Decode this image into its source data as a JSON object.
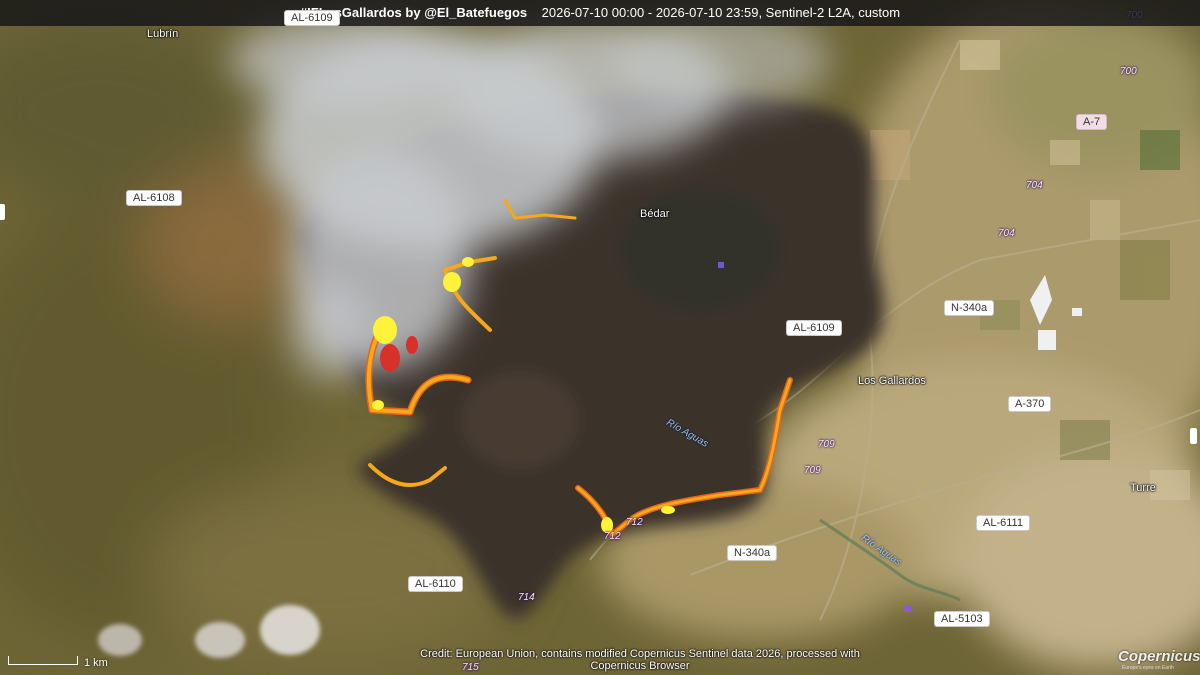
{
  "title": {
    "hashtag": "#IFLosGallardos",
    "author": "by @El_Batefuegos",
    "details": "2026-07-10 00:00 - 2026-07-10 23:59, Sentinel-2 L2A, custom"
  },
  "places": {
    "lubrin": "Lubrín",
    "bedar": "Bédar",
    "los_gallardos": "Los Gallardos",
    "turre": "Turre"
  },
  "roads": {
    "al6109_top": "AL-6109",
    "al6108": "AL-6108",
    "a7": "A-7",
    "n340a_east": "N-340a",
    "al6109_mid": "AL-6109",
    "a370": "A-370",
    "al6111": "AL-6111",
    "n340a_south": "N-340a",
    "al6110": "AL-6110",
    "al5103": "AL-5103"
  },
  "km_markers": {
    "k700a": "700",
    "k700b": "700",
    "k704a": "704",
    "k704b": "704",
    "k709a": "709",
    "k709b": "709",
    "k712a": "712",
    "k712b": "712",
    "k714": "714",
    "k715": "715"
  },
  "rivers": {
    "aguas_west": "Río Aguas",
    "aguas_east": "Río Aguas"
  },
  "scale": {
    "label": "1 km"
  },
  "credit": "Credit: European Union, contains modified Copernicus Sentinel data 2026, processed with Copernicus Browser",
  "logo": {
    "name": "Copernicus",
    "tagline": "Europe's eyes on Earth"
  },
  "colors": {
    "burn_scar": "#3b322c",
    "active_fire": "#f4a81a",
    "fire_core": "#fff23a",
    "smoke": "#c9ccd0",
    "vegetation": "#6e6536",
    "farmland": "#b7a57d"
  }
}
